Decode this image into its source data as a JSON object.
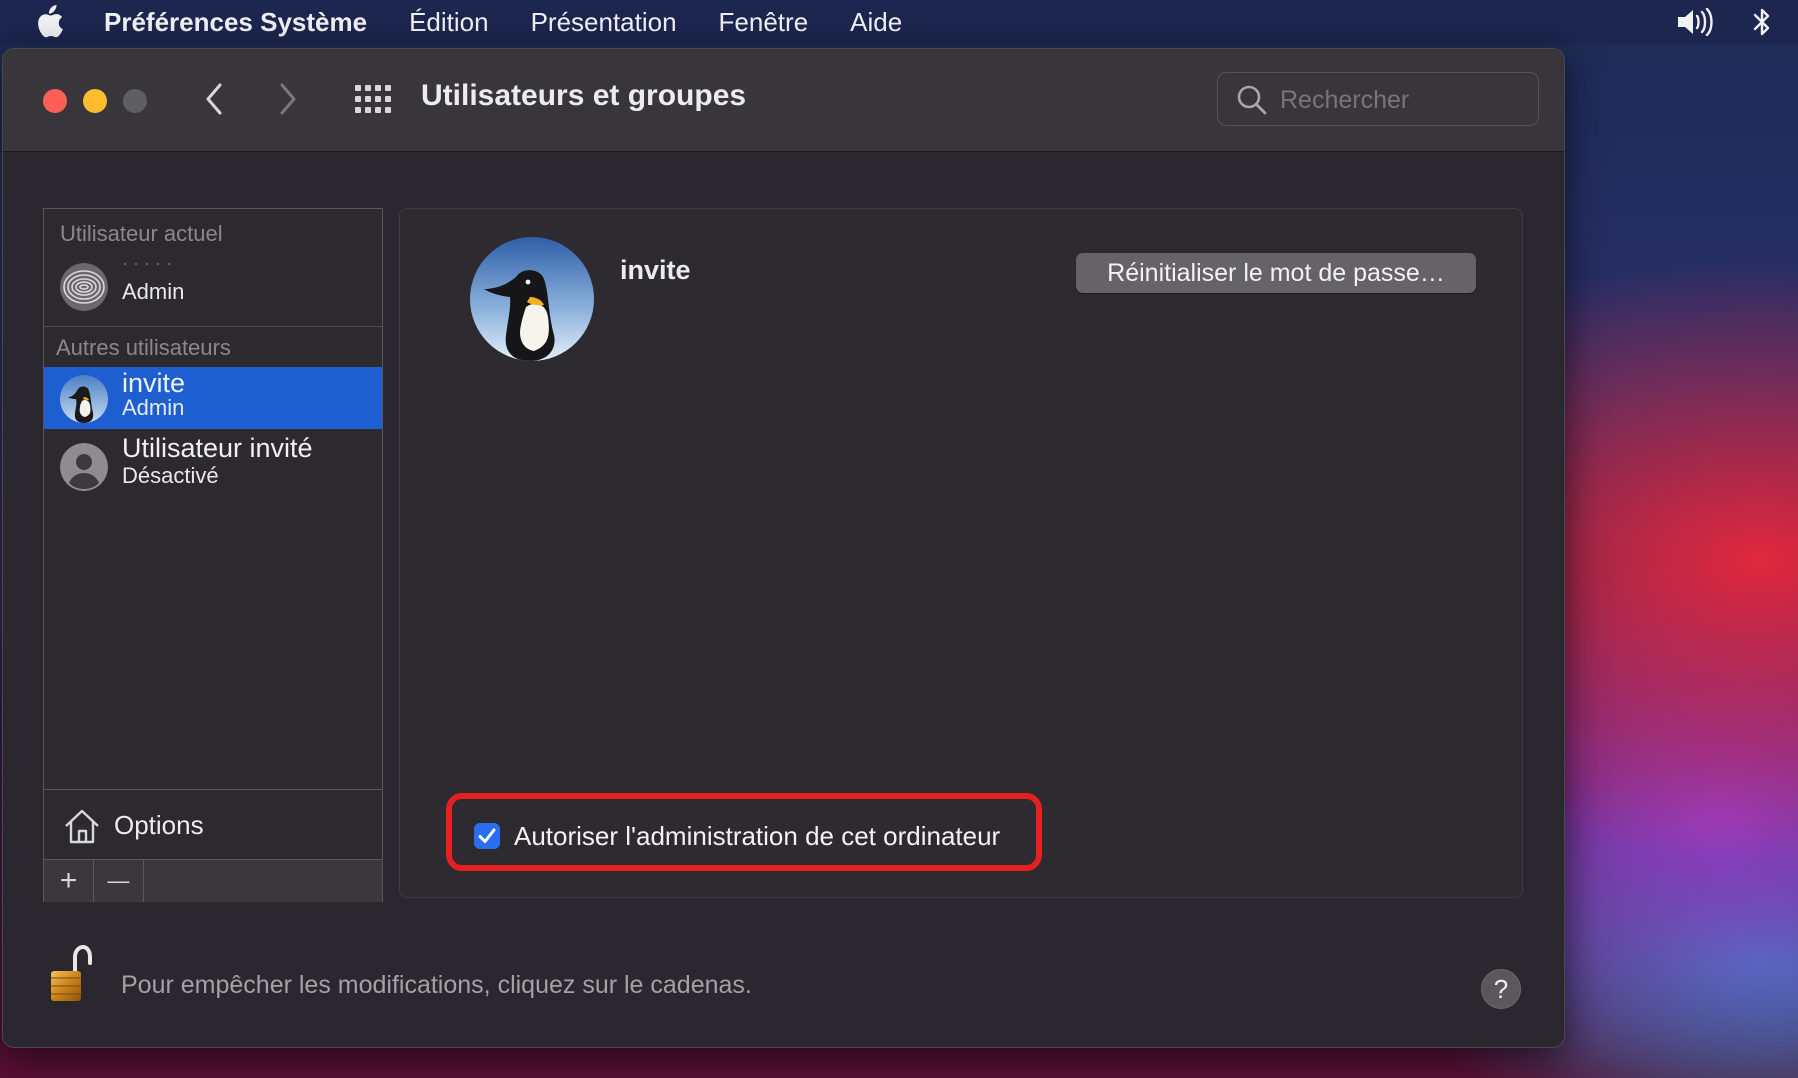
{
  "menubar": {
    "app_name": "Préférences Système",
    "items": [
      "Édition",
      "Présentation",
      "Fenêtre",
      "Aide"
    ]
  },
  "window": {
    "title": "Utilisateurs et groupes",
    "search_placeholder": "Rechercher"
  },
  "sidebar": {
    "current_user_header": "Utilisateur actuel",
    "current_user": {
      "name": "· · · · ·",
      "role": "Admin"
    },
    "other_users_header": "Autres utilisateurs",
    "other_users": [
      {
        "name": "invite",
        "role": "Admin",
        "selected": true
      },
      {
        "name": "Utilisateur invité",
        "role": "Désactivé",
        "selected": false
      }
    ],
    "options_label": "Options",
    "add_label": "+",
    "remove_label": "—"
  },
  "panel": {
    "username": "invite",
    "reset_button": "Réinitialiser le mot de passe…",
    "admin_checkbox_label": "Autoriser l'administration de cet ordinateur",
    "admin_checked": true
  },
  "footer": {
    "lock_text": "Pour empêcher les modifications, cliquez sur le cadenas.",
    "help_label": "?"
  },
  "colors": {
    "selection": "#1d5fd1",
    "highlight_box": "#e61f1f",
    "checkbox": "#2a6ef0"
  }
}
